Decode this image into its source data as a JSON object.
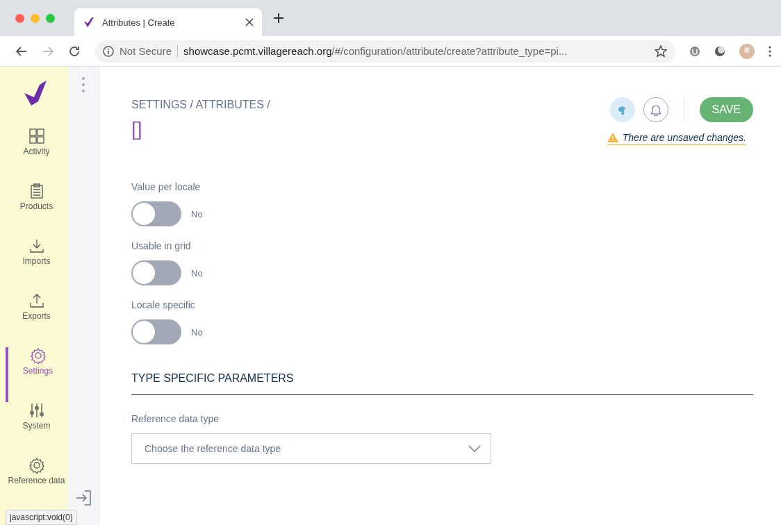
{
  "browser": {
    "tab_title": "Attributes | Create",
    "security": "Not Secure",
    "url_host": "showcase.pcmt.villagereach.org",
    "url_path": "/#/configuration/attribute/create?attribute_type=pi..."
  },
  "sidebar": {
    "items": [
      {
        "label": "Activity",
        "kind": "grid",
        "selected": false
      },
      {
        "label": "Products",
        "kind": "clipboard",
        "selected": false
      },
      {
        "label": "Imports",
        "kind": "import",
        "selected": false
      },
      {
        "label": "Exports",
        "kind": "export",
        "selected": false
      },
      {
        "label": "Settings",
        "kind": "gear",
        "selected": true
      },
      {
        "label": "System",
        "kind": "sliders",
        "selected": false
      },
      {
        "label": "Reference data",
        "kind": "gear",
        "selected": false
      }
    ]
  },
  "header": {
    "breadcrumb": "SETTINGS / ATTRIBUTES /",
    "title": "[]",
    "save": "SAVE",
    "warning": "There are unsaved changes."
  },
  "toggles": [
    {
      "label": "Value per locale",
      "on": false,
      "value": "No"
    },
    {
      "label": "Usable in grid",
      "on": false,
      "value": "No"
    },
    {
      "label": "Locale specific",
      "on": false,
      "value": "No"
    }
  ],
  "section": {
    "title": "TYPE SPECIFIC PARAMETERS",
    "field_label": "Reference data type",
    "placeholder": "Choose the reference data type"
  },
  "status_link": "javascript:void(0)"
}
